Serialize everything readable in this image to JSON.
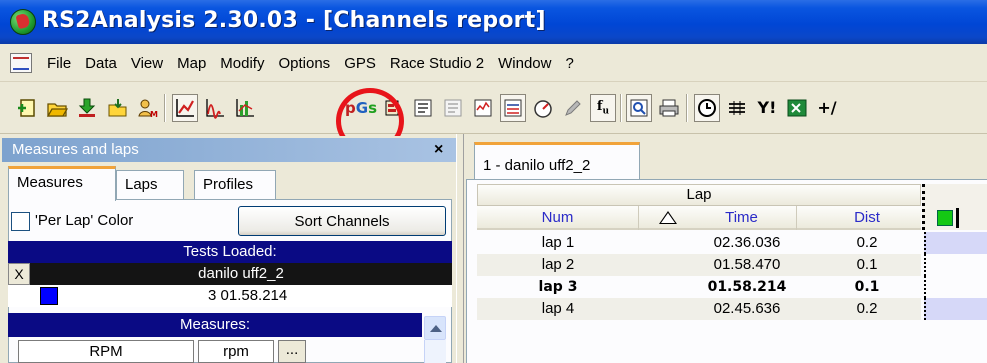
{
  "window": {
    "title": "RS2Analysis 2.30.03 - [Channels report]"
  },
  "menu": {
    "items": [
      "File",
      "Data",
      "View",
      "Map",
      "Modify",
      "Options",
      "GPS",
      "Race Studio 2",
      "Window",
      "?"
    ]
  },
  "toolbar": {
    "icons": [
      "new-file-icon",
      "open-folder-icon",
      "download-icon",
      "import-icon",
      "profile-icon",
      "line-chart-icon",
      "wave-icon",
      "bar-chart-icon",
      "pgs-icon",
      "histogram-icon",
      "report-icon",
      "report-grey-icon",
      "chart-frame-icon",
      "gauge-icon",
      "pencil-icon",
      "fx-icon",
      "zoom-icon",
      "print-icon",
      "clock-icon",
      "split-icon",
      "yy-icon",
      "excel-icon",
      "plus-minus-icon"
    ],
    "pgs_label": "pGs",
    "yi_label": "Y!",
    "pm_label": "+/"
  },
  "left_panel": {
    "header": "Measures and laps",
    "close": "×",
    "tabs": [
      {
        "label": "Measures",
        "active": true
      },
      {
        "label": "Laps",
        "active": false
      },
      {
        "label": "Profiles",
        "active": false
      }
    ],
    "per_lap_color": {
      "label": "'Per Lap' Color",
      "checked": false
    },
    "sort_button": "Sort Channels",
    "tests_loaded_label": "Tests Loaded:",
    "test": {
      "x_label": "X",
      "name": "danilo uff2_2"
    },
    "selected_lap": {
      "swatch_color": "#0000ff",
      "text": "3 01.58.214"
    },
    "measures_label": "Measures:",
    "measure_row": {
      "name": "RPM",
      "unit": "rpm",
      "more": "..."
    }
  },
  "right_panel": {
    "tab_label": "1 - danilo uff2_2",
    "group_header": "Lap",
    "columns": [
      "Num",
      "Time",
      "Dist"
    ],
    "rows": [
      {
        "num": "lap 1",
        "time": "02.36.036",
        "dist": "0.2",
        "bold": false
      },
      {
        "num": "lap 2",
        "time": "01.58.470",
        "dist": "0.1",
        "bold": false
      },
      {
        "num": "lap 3",
        "time": "01.58.214",
        "dist": "0.1",
        "bold": true
      },
      {
        "num": "lap 4",
        "time": "02.45.636",
        "dist": "0.2",
        "bold": false
      }
    ]
  },
  "colors": {
    "highlight_circle": "#e8141a",
    "title_bar": "#0046d5",
    "selected_bar": "#0a0a84"
  }
}
